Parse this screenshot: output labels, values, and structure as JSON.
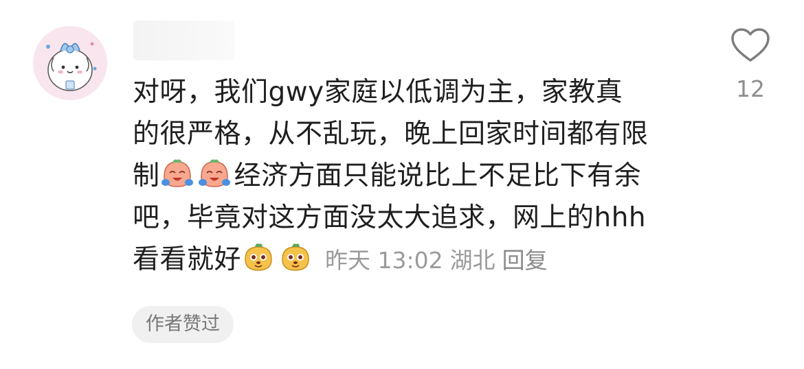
{
  "comment": {
    "lines": [
      "对呀，我们gwy家庭以低调为主，家教真",
      "的很严格，从不乱玩，晚上回家时间都有限",
      "制",
      "经济方面只能说比上不足比下有余",
      "吧，毕竟对这方面没太大追求，网上的hhh",
      "看看就好"
    ],
    "time": "昨天 13:02",
    "location": "湖北",
    "reply_label": "回复"
  },
  "likes": {
    "count": "12",
    "icon": "heart-outline-icon"
  },
  "badge": {
    "label": "作者赞过"
  },
  "emojis": [
    "laugh-cry-emoji",
    "laugh-cry-emoji",
    "dog-face-emoji",
    "dog-face-emoji"
  ]
}
